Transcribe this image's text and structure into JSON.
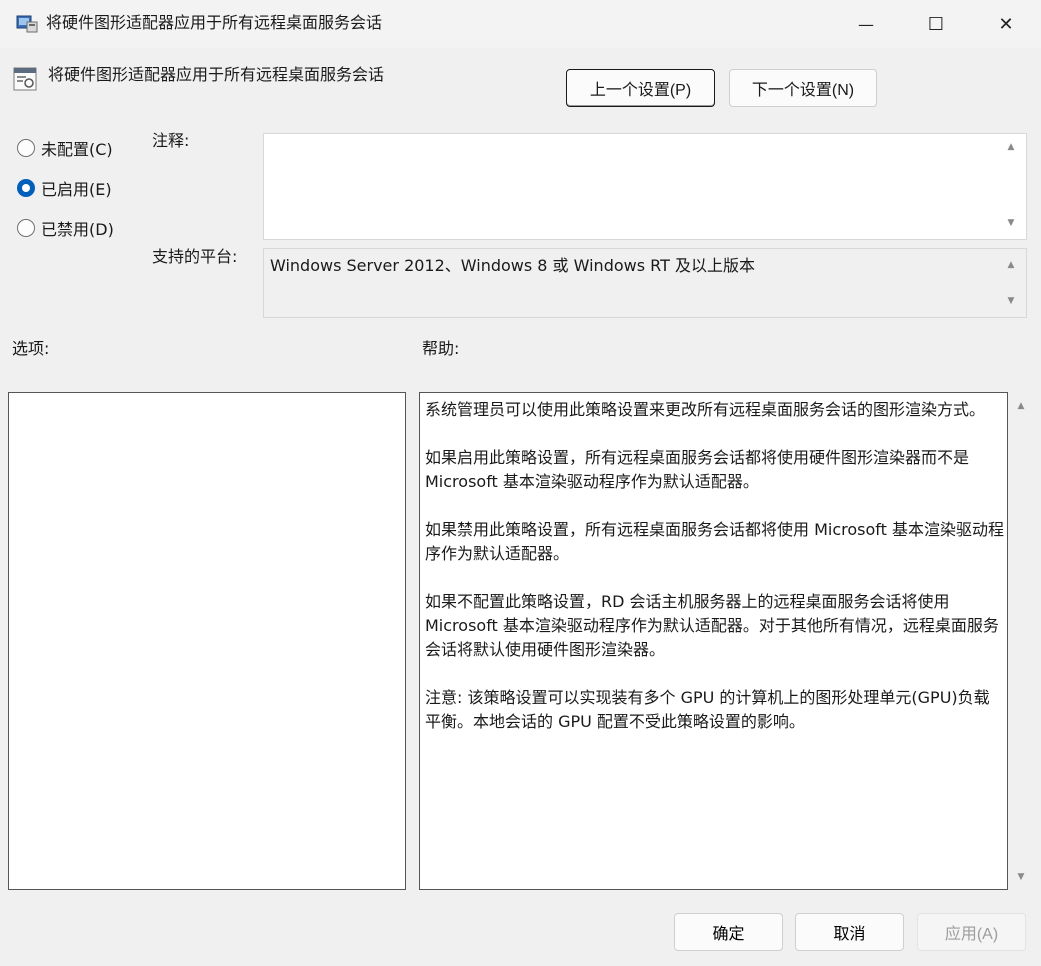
{
  "window": {
    "title": "将硬件图形适配器应用于所有远程桌面服务会话",
    "minimize_glyph": "—",
    "maximize_glyph": "☐",
    "close_glyph": "✕"
  },
  "policy_header": {
    "title": "将硬件图形适配器应用于所有远程桌面服务会话",
    "icon": "policy-setting-icon"
  },
  "navigation": {
    "prev_label": "上一个设置(P)",
    "next_label": "下一个设置(N)"
  },
  "state_options": [
    {
      "label": "未配置(C)",
      "checked": false
    },
    {
      "label": "已启用(E)",
      "checked": true
    },
    {
      "label": "已禁用(D)",
      "checked": false
    }
  ],
  "comment": {
    "label": "注释:",
    "value": ""
  },
  "supported_platforms": {
    "label": "支持的平台:",
    "value": "Windows Server 2012、Windows 8 或 Windows RT 及以上版本"
  },
  "options": {
    "label": "选项:"
  },
  "help": {
    "label": "帮助:",
    "paragraphs": [
      "系统管理员可以使用此策略设置来更改所有远程桌面服务会话的图形渲染方式。",
      "如果启用此策略设置，所有远程桌面服务会话都将使用硬件图形渲染器而不是 Microsoft 基本渲染驱动程序作为默认适配器。",
      "如果禁用此策略设置，所有远程桌面服务会话都将使用 Microsoft 基本渲染驱动程序作为默认适配器。",
      "如果不配置此策略设置，RD 会话主机服务器上的远程桌面服务会话将使用 Microsoft 基本渲染驱动程序作为默认适配器。对于其他所有情况，远程桌面服务会话将默认使用硬件图形渲染器。",
      "注意: 该策略设置可以实现装有多个 GPU 的计算机上的图形处理单元(GPU)负载平衡。本地会话的 GPU 配置不受此策略设置的影响。"
    ]
  },
  "buttons": {
    "ok": "确定",
    "cancel": "取消",
    "apply": "应用(A)"
  },
  "colors": {
    "accent": "#005fb8",
    "background": "#f0f0f0"
  }
}
